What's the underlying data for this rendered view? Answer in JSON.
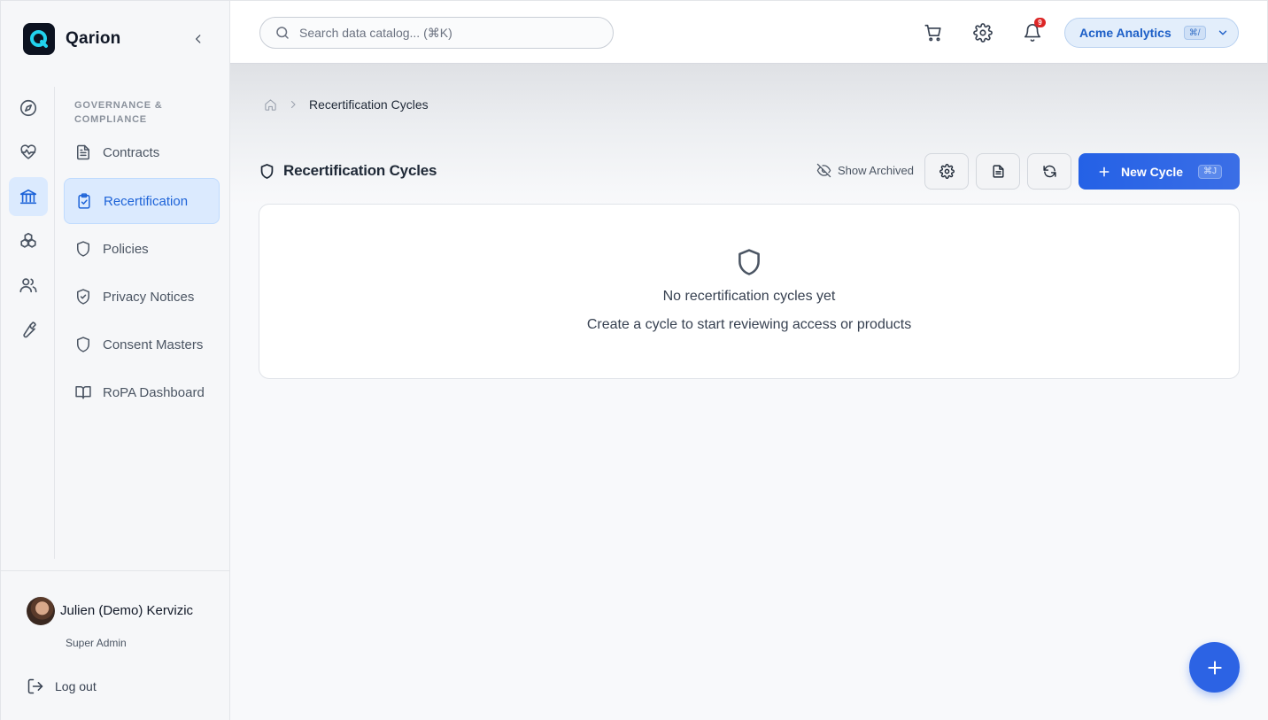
{
  "brand": {
    "name": "Qarion"
  },
  "rail": {
    "items": [
      {
        "icon": "compass-icon",
        "label": ""
      },
      {
        "icon": "heart-pulse-icon",
        "label": ""
      },
      {
        "icon": "landmark-icon",
        "label": ""
      },
      {
        "icon": "boxes-icon",
        "label": ""
      },
      {
        "icon": "users-icon",
        "label": ""
      },
      {
        "icon": "wrench-icon",
        "label": ""
      }
    ],
    "active_index": 2
  },
  "nav": {
    "section_title": "GOVERNANCE & COMPLIANCE",
    "items": [
      {
        "label": "Contracts",
        "icon": "file-text-icon"
      },
      {
        "label": "Recertification",
        "icon": "clipboard-check-icon"
      },
      {
        "label": "Policies",
        "icon": "shield-icon"
      },
      {
        "label": "Privacy Notices",
        "icon": "shield-check-icon"
      },
      {
        "label": "Consent Masters",
        "icon": "shield-icon"
      },
      {
        "label": "RoPA Dashboard",
        "icon": "book-open-icon"
      }
    ],
    "active_index": 1
  },
  "user": {
    "name": "Julien (Demo) Kervizic",
    "role": "Super Admin",
    "logout_label": "Log out"
  },
  "topbar": {
    "search_placeholder": "Search data catalog... (⌘K)",
    "notification_count": "9",
    "org_name": "Acme Analytics",
    "org_shortcut": "⌘/"
  },
  "breadcrumb": {
    "current": "Recertification Cycles"
  },
  "page": {
    "title": "Recertification Cycles",
    "show_archived_label": "Show Archived",
    "new_button_label": "New Cycle",
    "new_button_shortcut": "⌘J"
  },
  "empty_state": {
    "title": "No recertification cycles yet",
    "subtitle": "Create a cycle to start reviewing access or products"
  },
  "colors": {
    "accent": "#2461e6",
    "active_bg": "#dbeafe",
    "active_text": "#1d63d8",
    "badge": "#dc2626"
  }
}
